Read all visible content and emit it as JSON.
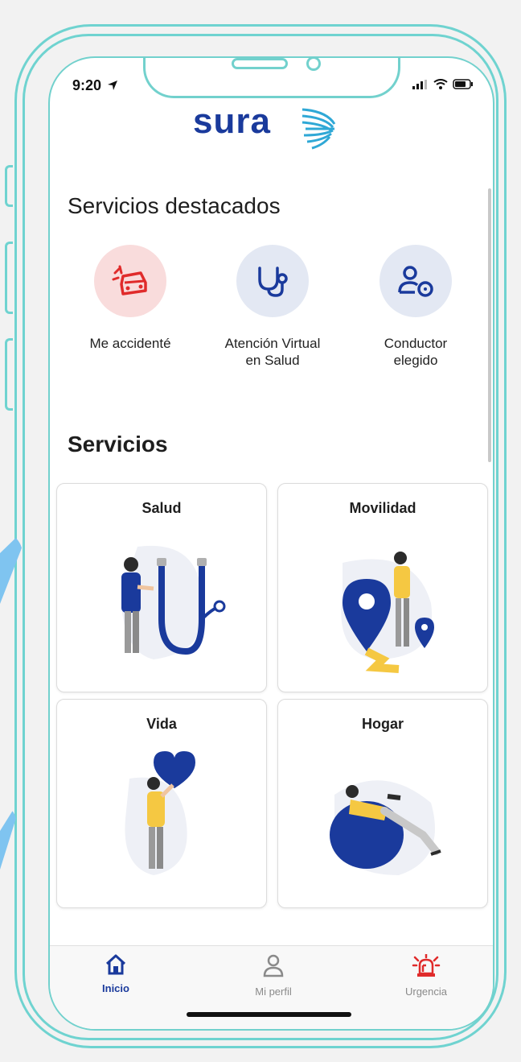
{
  "status": {
    "time": "9:20"
  },
  "app": {
    "logo_text": "sura"
  },
  "featured": {
    "heading": "Servicios destacados",
    "items": [
      {
        "label": "Me accidenté",
        "icon": "car-crash-icon",
        "bg": "#f9dcdc",
        "color": "#e02b2b"
      },
      {
        "label": "Atención Virtual\nen Salud",
        "icon": "stethoscope-icon",
        "bg": "#e3e8f3",
        "color": "#1a3a9c"
      },
      {
        "label": "Conductor\nelegido",
        "icon": "driver-icon",
        "bg": "#e3e8f3",
        "color": "#1a3a9c"
      }
    ]
  },
  "services": {
    "heading": "Servicios",
    "cards": [
      {
        "title": "Salud",
        "icon": "doctor-stethoscope-illustration"
      },
      {
        "title": "Movilidad",
        "icon": "map-pin-illustration"
      },
      {
        "title": "Vida",
        "icon": "heart-person-illustration"
      },
      {
        "title": "Hogar",
        "icon": "beanbag-relax-illustration"
      }
    ]
  },
  "tabbar": {
    "items": [
      {
        "label": "Inicio",
        "icon": "home-icon",
        "active": true
      },
      {
        "label": "Mi perfil",
        "icon": "user-icon",
        "active": false
      },
      {
        "label": "Urgencia",
        "icon": "siren-icon",
        "active": false
      }
    ]
  },
  "colors": {
    "frame": "#6fd3d0",
    "brand": "#1a3a9c",
    "alert": "#e02b2b",
    "illustration_yellow": "#f5c842"
  }
}
